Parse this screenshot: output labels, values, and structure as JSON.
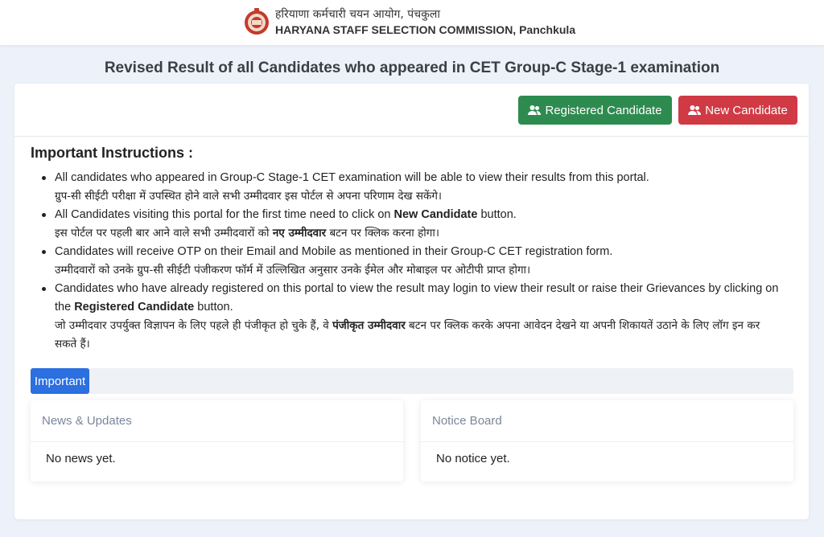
{
  "header": {
    "org_hindi": "हरियाणा कर्मचारी चयन आयोग, पंचकुला",
    "org_english": "HARYANA STAFF SELECTION COMMISSION, Panchkula",
    "logo_icon": "hssc-emblem-icon"
  },
  "page_title": "Revised Result of all Candidates who appeared in CET Group-C Stage-1 examination",
  "buttons": {
    "registered": "Registered Candidate",
    "new": "New Candidate",
    "icon": "users-icon",
    "registered_color": "#2e8b4f",
    "new_color": "#d03a44"
  },
  "instructions": {
    "title": "Important Instructions :",
    "items": [
      {
        "en": "All candidates who appeared in Group-C Stage-1 CET examination will be able to view their results from this portal.",
        "hi": "ग्रुप-सी सीईटी परीक्षा में उपस्थित होने वाले सभी उम्मीदवार इस पोर्टल से अपना परिणाम देख सकेंगे।"
      },
      {
        "en_pre": "All Candidates visiting this portal for the first time need to click on ",
        "en_bold": "New Candidate",
        "en_post": " button.",
        "hi_pre": "इस पोर्टल पर पहली बार आने वाले सभी उम्मीदवारों को ",
        "hi_bold": "नए उम्मीदवार",
        "hi_post": " बटन पर क्लिक करना होगा।"
      },
      {
        "en": "Candidates will receive OTP on their Email and Mobile as mentioned in their Group-C CET registration form.",
        "hi": "उम्मीदवारों को उनके ग्रुप-सी सीईटी पंजीकरण फॉर्म में उल्लिखित अनुसार उनके ईमेल और मोबाइल पर ओटीपी प्राप्त होगा।"
      },
      {
        "en_pre": "Candidates who have already registered on this portal to view the result may login to view their result or raise their Grievances by clicking on the ",
        "en_bold": "Registered Candidate",
        "en_post": " button.",
        "hi_pre": "जो उम्मीदवार उपर्युक्त विज्ञापन के लिए पहले ही पंजीकृत हो चुके हैं, वे ",
        "hi_bold": "पंजीकृत उम्मीदवार",
        "hi_post": " बटन पर क्लिक करके अपना आवेदन देखने या अपनी शिकायतें उठाने के लिए लॉग इन कर सकते हैं।"
      }
    ]
  },
  "tabs": {
    "active": "Important",
    "active_color": "#2b6fe0"
  },
  "panels": {
    "news": {
      "title": "News & Updates",
      "body": "No news yet."
    },
    "notice": {
      "title": "Notice Board",
      "body": "No notice yet."
    }
  }
}
